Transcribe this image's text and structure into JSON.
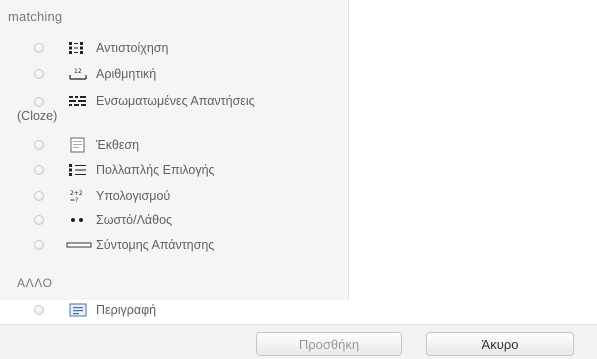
{
  "dialog": {
    "section_matching": "matching",
    "section_other": "ΑΛΛΟ",
    "question_types": [
      {
        "label": "Αντιστοίχηση",
        "icon": "matching-icon",
        "selected": false
      },
      {
        "label": "Αριθμητική",
        "icon": "numerical-icon",
        "selected": false
      },
      {
        "label": "Ενσωματωμένες Απαντήσεις",
        "label_cont": "(Cloze)",
        "icon": "cloze-icon",
        "selected": false
      },
      {
        "label": "Έκθεση",
        "icon": "essay-icon",
        "selected": false
      },
      {
        "label": "Πολλαπλής Επιλογής",
        "icon": "multichoice-icon",
        "selected": false
      },
      {
        "label": "Υπολογισμού",
        "icon": "calculated-icon",
        "selected": false
      },
      {
        "label": "Σωστό/Λάθος",
        "icon": "truefalse-icon",
        "selected": false
      },
      {
        "label": "Σύντομης Απάντησης",
        "icon": "shortanswer-icon",
        "selected": false
      }
    ],
    "other_types": [
      {
        "label": "Περιγραφή",
        "icon": "description-icon",
        "selected": false
      }
    ]
  },
  "footer": {
    "add_label": "Προσθήκη",
    "cancel_label": "Άκυρο"
  }
}
